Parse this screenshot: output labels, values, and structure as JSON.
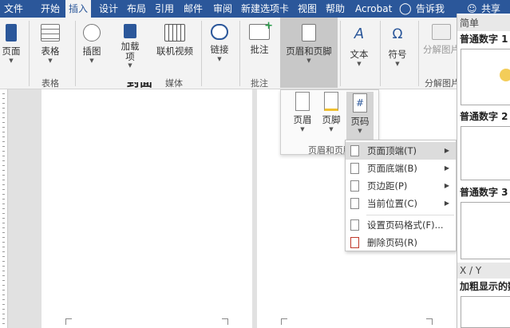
{
  "menubar": {
    "tabs": [
      "文件",
      "开始",
      "插入",
      "设计",
      "布局",
      "引用",
      "邮件",
      "审阅",
      "新建选项卡",
      "视图",
      "帮助",
      "Acrobat"
    ],
    "active_tab": "插入",
    "tell_me": "告诉我",
    "share": "共享"
  },
  "ribbon": {
    "buttons": {
      "page": "页面",
      "table": "表格",
      "illustration": "插图",
      "addins": "加载项",
      "online_video": "联机视频",
      "link": "链接",
      "comment": "批注",
      "header_footer": "页眉和页脚",
      "text": "文本",
      "symbol": "符号",
      "split_image": "分解图片"
    },
    "groups": {
      "table": "表格",
      "media": "媒体",
      "comment": "批注",
      "split_image": "分解图片"
    }
  },
  "hf_panel": {
    "header": "页眉",
    "footer": "页脚",
    "page_number": "页码",
    "group_label": "页眉和页脚"
  },
  "context_menu": {
    "top_of_page": "页面顶端(T)",
    "bottom_of_page": "页面底端(B)",
    "page_margin": "页边距(P)",
    "current_position": "当前位置(C)",
    "format_page_numbers": "设置页码格式(F)...",
    "remove_page_numbers": "删除页码(R)"
  },
  "gallery": {
    "simple": "简单",
    "plain_number_1": "普通数字 1",
    "plain_number_2": "普通数字 2",
    "plain_number_3": "普通数字 3",
    "xy": "X / Y",
    "bold_numbers": "加粗显示的数"
  },
  "document": {
    "partial_text": "封面"
  },
  "colors": {
    "brand": "#2b579a",
    "ribbon_bg": "#f3f3f3",
    "highlight": "#dcdcdc",
    "cursor": "#f0c030"
  }
}
